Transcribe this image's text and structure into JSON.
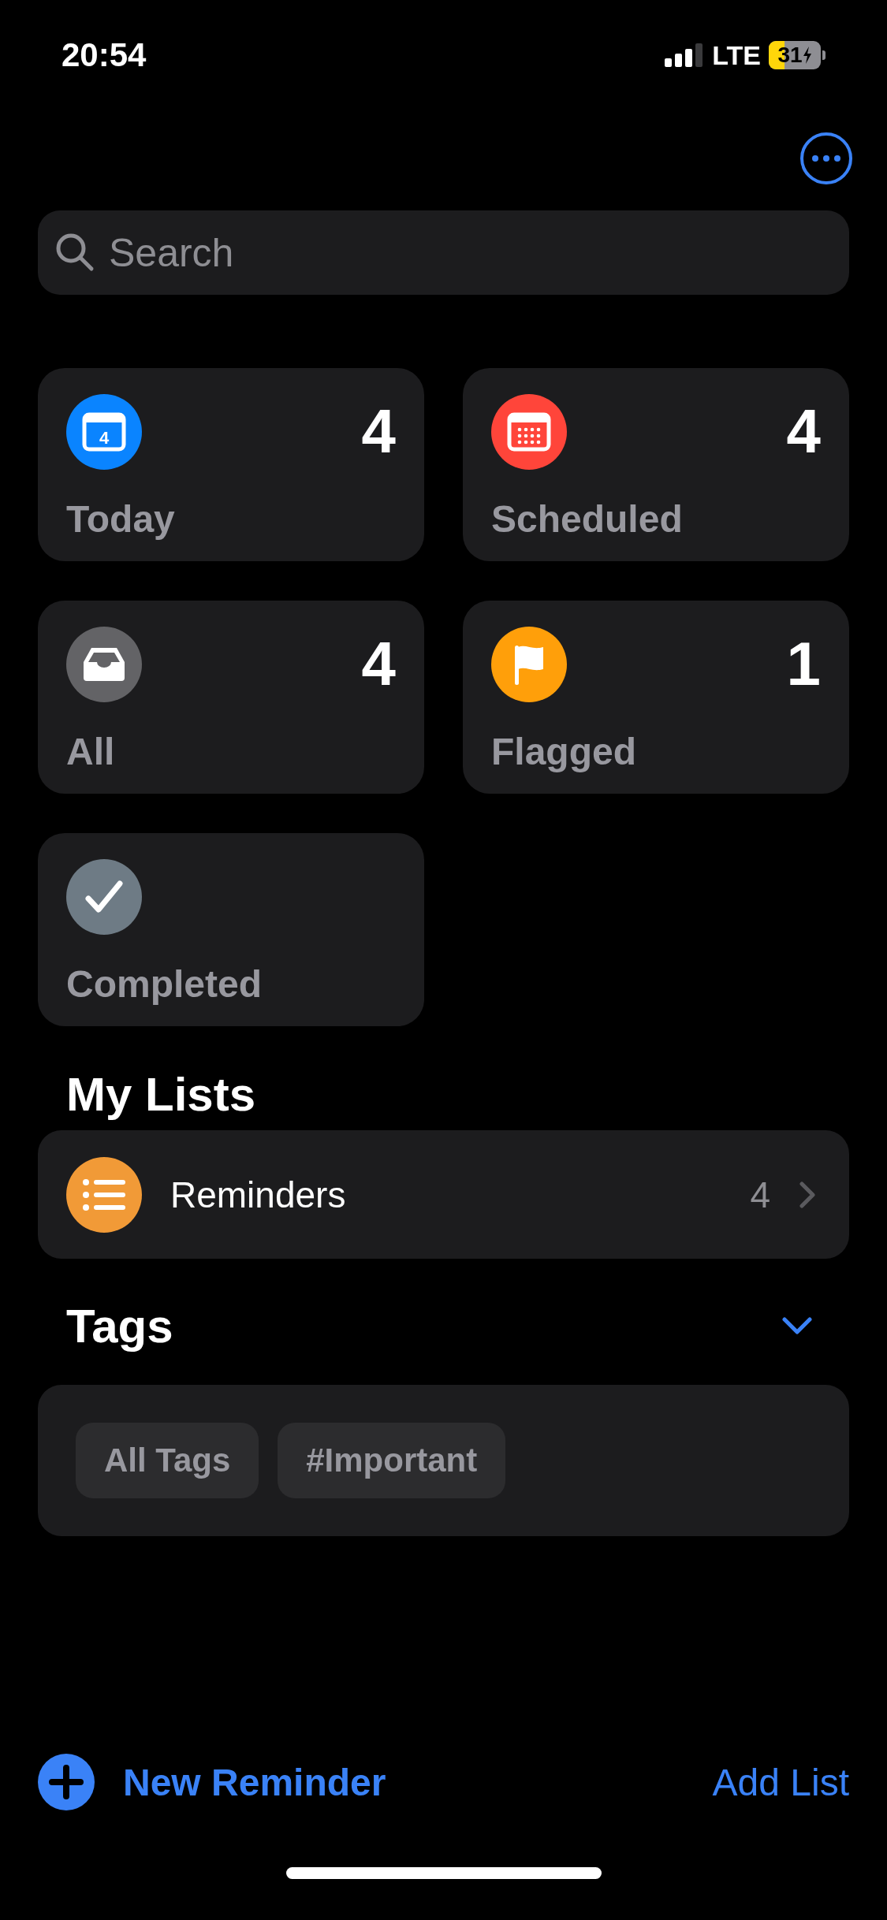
{
  "status_bar": {
    "time": "20:54",
    "network": "LTE",
    "battery": "31"
  },
  "search": {
    "placeholder": "Search"
  },
  "smart_lists": [
    {
      "kind": "today",
      "label": "Today",
      "count": "4",
      "color": "#0a84ff"
    },
    {
      "kind": "scheduled",
      "label": "Scheduled",
      "count": "4",
      "color": "#ff453a"
    },
    {
      "kind": "all",
      "label": "All",
      "count": "4",
      "color": "#636366"
    },
    {
      "kind": "flagged",
      "label": "Flagged",
      "count": "1",
      "color": "#ff9f0a"
    },
    {
      "kind": "completed",
      "label": "Completed",
      "color": "#6e7b85"
    }
  ],
  "today_icon_number": "4",
  "my_lists": {
    "title": "My Lists",
    "items": [
      {
        "name": "Reminders",
        "count": "4",
        "color": "#f19a37"
      }
    ]
  },
  "tags": {
    "title": "Tags",
    "expanded": true,
    "items": [
      "All Tags",
      "#Important"
    ]
  },
  "toolbar": {
    "new_reminder": "New Reminder",
    "add_list": "Add List"
  }
}
